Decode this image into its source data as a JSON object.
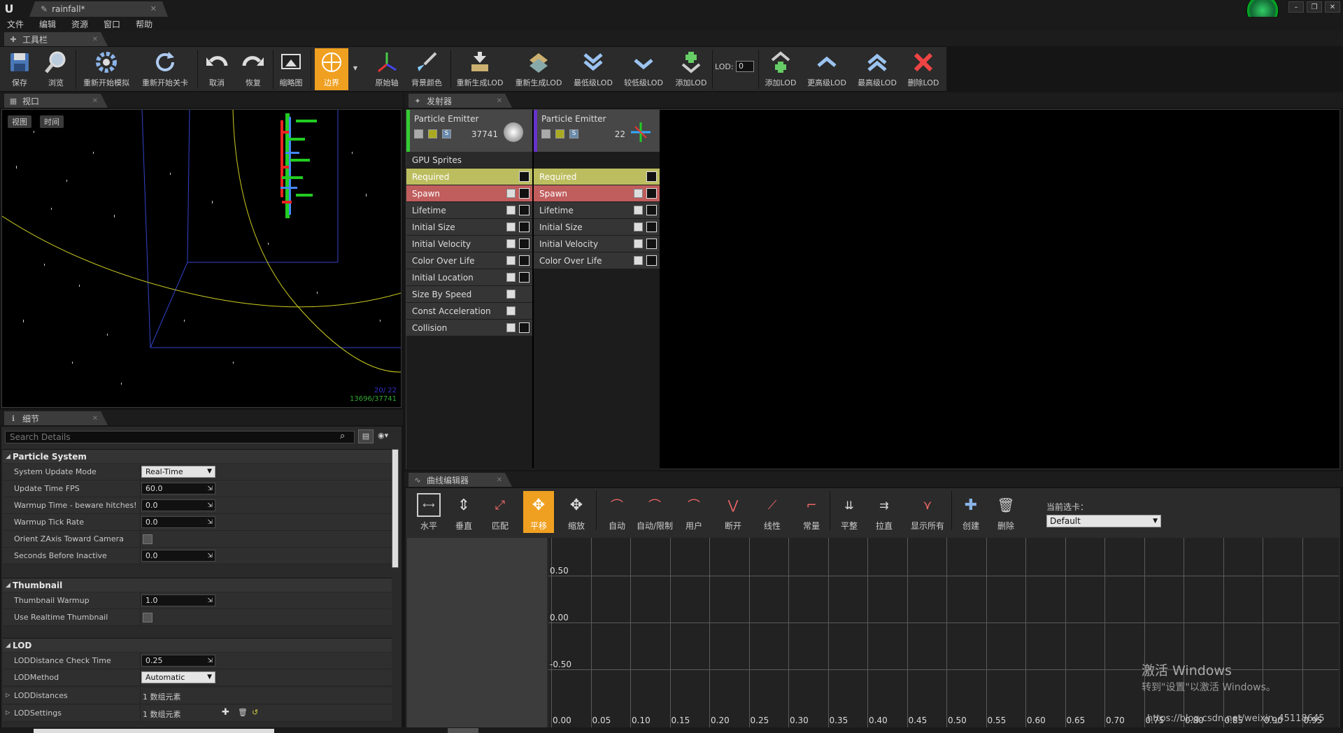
{
  "window": {
    "doc_tab": "rainfall*",
    "logo": "U"
  },
  "menu": [
    "文件",
    "编辑",
    "资源",
    "窗口",
    "帮助"
  ],
  "toolbar_tab": "工具栏",
  "toolbar": {
    "save": "保存",
    "browse": "浏览",
    "restart_sim": "重新开始模拟",
    "restart_level": "重新开始关卡",
    "undo": "取消",
    "redo": "恢复",
    "thumbnail": "缩略图",
    "bounds": "边界",
    "origin_axis": "原始轴",
    "bg_color": "背景颜色",
    "regen_lod_1": "重新生成LOD",
    "regen_lod_2": "重新生成LOD",
    "lowest_lod": "最低级LOD",
    "lower_lod": "较低级LOD",
    "add_lod_1": "添加LOD",
    "lod_label": "LOD:",
    "lod_value": "0",
    "add_lod_2": "添加LOD",
    "higher_lod": "更高级LOD",
    "highest_lod": "最高级LOD",
    "delete_lod": "删除LOD"
  },
  "viewport": {
    "tab": "视口",
    "view_btn": "视图",
    "time_btn": "时间",
    "stat1": "20/ 22",
    "stat2": "13696/37741"
  },
  "details": {
    "tab": "细节",
    "search_placeholder": "Search Details",
    "categories": {
      "particle_system": "Particle System",
      "thumbnail": "Thumbnail",
      "lod": "LOD"
    },
    "props": {
      "system_update_mode": {
        "label": "System Update Mode",
        "value": "Real-Time"
      },
      "update_time_fps": {
        "label": "Update Time FPS",
        "value": "60.0"
      },
      "warmup_time": {
        "label": "Warmup Time - beware hitches!",
        "value": "0.0"
      },
      "warmup_tick_rate": {
        "label": "Warmup Tick Rate",
        "value": "0.0"
      },
      "orient_zaxis": {
        "label": "Orient ZAxis Toward Camera"
      },
      "seconds_before_inactive": {
        "label": "Seconds Before Inactive",
        "value": "0.0"
      },
      "thumbnail_warmup": {
        "label": "Thumbnail Warmup",
        "value": "1.0"
      },
      "use_realtime_thumbnail": {
        "label": "Use Realtime Thumbnail"
      },
      "lod_distance_check_time": {
        "label": "LODDistance Check Time",
        "value": "0.25"
      },
      "lod_method": {
        "label": "LODMethod",
        "value": "Automatic"
      },
      "lod_distances": {
        "label": "LODDistances",
        "value": "1 数组元素"
      },
      "lod_settings": {
        "label": "LODSettings",
        "value": "1 数组元素"
      }
    }
  },
  "emitters": {
    "tab": "发射器",
    "columns": [
      {
        "name": "Particle Emitter",
        "count": "37741",
        "type_label": "GPU Sprites",
        "modules": [
          "Required",
          "Spawn",
          "Lifetime",
          "Initial Size",
          "Initial Velocity",
          "Color Over Life",
          "Initial Location",
          "Size By Speed",
          "Const Acceleration",
          "Collision"
        ]
      },
      {
        "name": "Particle Emitter",
        "count": "22",
        "modules": [
          "Required",
          "Spawn",
          "Lifetime",
          "Initial Size",
          "Initial Velocity",
          "Color Over Life"
        ]
      }
    ],
    "colors": {
      "required": "#bcbd5f",
      "spawn": "#c05d5d",
      "emitter1": "#33cc33",
      "emitter2": "#6633cc"
    }
  },
  "curve_editor": {
    "tab": "曲线编辑器",
    "buttons": {
      "horizontal": "水平",
      "vertical": "垂直",
      "fit": "匹配",
      "pan": "平移",
      "zoom": "缩放",
      "auto": "自动",
      "auto_clamp": "自动/限制",
      "user": "用户",
      "break": "断开",
      "linear": "线性",
      "constant": "常量",
      "flatten": "平整",
      "straighten": "拉直",
      "show_all": "显示所有",
      "create": "创建",
      "delete": "删除"
    },
    "current_tab_label": "当前选卡：",
    "current_tab_value": "Default",
    "y_labels": [
      "0.50",
      "0.00",
      "-0.50"
    ],
    "x_labels": [
      "0.00",
      "0.05",
      "0.10",
      "0.15",
      "0.20",
      "0.25",
      "0.30",
      "0.35",
      "0.40",
      "0.45",
      "0.50",
      "0.55",
      "0.60",
      "0.65",
      "0.70",
      "0.75",
      "0.80",
      "0.85",
      "0.90",
      "0.95"
    ]
  },
  "watermark": {
    "line1": "激活 Windows",
    "line2": "转到\"设置\"以激活 Windows。",
    "csdn": "https://blog.csdn.net/weixin_45118645"
  }
}
